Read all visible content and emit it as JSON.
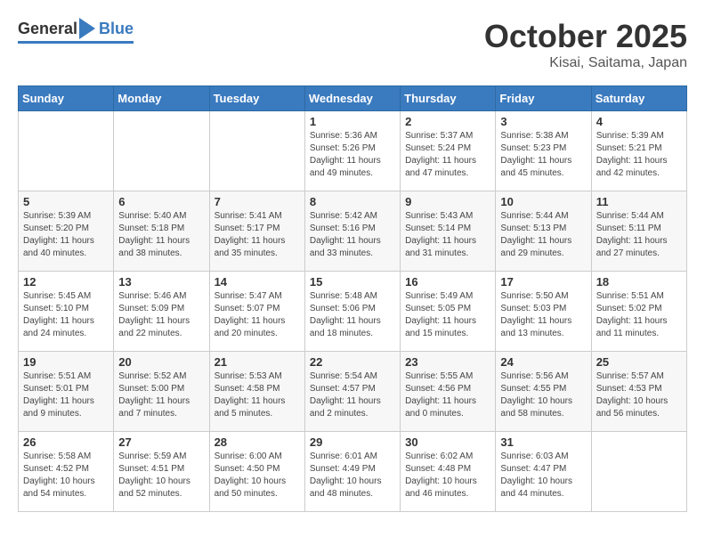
{
  "logo": {
    "general": "General",
    "blue": "Blue"
  },
  "title": "October 2025",
  "location": "Kisai, Saitama, Japan",
  "weekdays": [
    "Sunday",
    "Monday",
    "Tuesday",
    "Wednesday",
    "Thursday",
    "Friday",
    "Saturday"
  ],
  "weeks": [
    [
      {
        "day": "",
        "text": ""
      },
      {
        "day": "",
        "text": ""
      },
      {
        "day": "",
        "text": ""
      },
      {
        "day": "1",
        "text": "Sunrise: 5:36 AM\nSunset: 5:26 PM\nDaylight: 11 hours\nand 49 minutes."
      },
      {
        "day": "2",
        "text": "Sunrise: 5:37 AM\nSunset: 5:24 PM\nDaylight: 11 hours\nand 47 minutes."
      },
      {
        "day": "3",
        "text": "Sunrise: 5:38 AM\nSunset: 5:23 PM\nDaylight: 11 hours\nand 45 minutes."
      },
      {
        "day": "4",
        "text": "Sunrise: 5:39 AM\nSunset: 5:21 PM\nDaylight: 11 hours\nand 42 minutes."
      }
    ],
    [
      {
        "day": "5",
        "text": "Sunrise: 5:39 AM\nSunset: 5:20 PM\nDaylight: 11 hours\nand 40 minutes."
      },
      {
        "day": "6",
        "text": "Sunrise: 5:40 AM\nSunset: 5:18 PM\nDaylight: 11 hours\nand 38 minutes."
      },
      {
        "day": "7",
        "text": "Sunrise: 5:41 AM\nSunset: 5:17 PM\nDaylight: 11 hours\nand 35 minutes."
      },
      {
        "day": "8",
        "text": "Sunrise: 5:42 AM\nSunset: 5:16 PM\nDaylight: 11 hours\nand 33 minutes."
      },
      {
        "day": "9",
        "text": "Sunrise: 5:43 AM\nSunset: 5:14 PM\nDaylight: 11 hours\nand 31 minutes."
      },
      {
        "day": "10",
        "text": "Sunrise: 5:44 AM\nSunset: 5:13 PM\nDaylight: 11 hours\nand 29 minutes."
      },
      {
        "day": "11",
        "text": "Sunrise: 5:44 AM\nSunset: 5:11 PM\nDaylight: 11 hours\nand 27 minutes."
      }
    ],
    [
      {
        "day": "12",
        "text": "Sunrise: 5:45 AM\nSunset: 5:10 PM\nDaylight: 11 hours\nand 24 minutes."
      },
      {
        "day": "13",
        "text": "Sunrise: 5:46 AM\nSunset: 5:09 PM\nDaylight: 11 hours\nand 22 minutes."
      },
      {
        "day": "14",
        "text": "Sunrise: 5:47 AM\nSunset: 5:07 PM\nDaylight: 11 hours\nand 20 minutes."
      },
      {
        "day": "15",
        "text": "Sunrise: 5:48 AM\nSunset: 5:06 PM\nDaylight: 11 hours\nand 18 minutes."
      },
      {
        "day": "16",
        "text": "Sunrise: 5:49 AM\nSunset: 5:05 PM\nDaylight: 11 hours\nand 15 minutes."
      },
      {
        "day": "17",
        "text": "Sunrise: 5:50 AM\nSunset: 5:03 PM\nDaylight: 11 hours\nand 13 minutes."
      },
      {
        "day": "18",
        "text": "Sunrise: 5:51 AM\nSunset: 5:02 PM\nDaylight: 11 hours\nand 11 minutes."
      }
    ],
    [
      {
        "day": "19",
        "text": "Sunrise: 5:51 AM\nSunset: 5:01 PM\nDaylight: 11 hours\nand 9 minutes."
      },
      {
        "day": "20",
        "text": "Sunrise: 5:52 AM\nSunset: 5:00 PM\nDaylight: 11 hours\nand 7 minutes."
      },
      {
        "day": "21",
        "text": "Sunrise: 5:53 AM\nSunset: 4:58 PM\nDaylight: 11 hours\nand 5 minutes."
      },
      {
        "day": "22",
        "text": "Sunrise: 5:54 AM\nSunset: 4:57 PM\nDaylight: 11 hours\nand 2 minutes."
      },
      {
        "day": "23",
        "text": "Sunrise: 5:55 AM\nSunset: 4:56 PM\nDaylight: 11 hours\nand 0 minutes."
      },
      {
        "day": "24",
        "text": "Sunrise: 5:56 AM\nSunset: 4:55 PM\nDaylight: 10 hours\nand 58 minutes."
      },
      {
        "day": "25",
        "text": "Sunrise: 5:57 AM\nSunset: 4:53 PM\nDaylight: 10 hours\nand 56 minutes."
      }
    ],
    [
      {
        "day": "26",
        "text": "Sunrise: 5:58 AM\nSunset: 4:52 PM\nDaylight: 10 hours\nand 54 minutes."
      },
      {
        "day": "27",
        "text": "Sunrise: 5:59 AM\nSunset: 4:51 PM\nDaylight: 10 hours\nand 52 minutes."
      },
      {
        "day": "28",
        "text": "Sunrise: 6:00 AM\nSunset: 4:50 PM\nDaylight: 10 hours\nand 50 minutes."
      },
      {
        "day": "29",
        "text": "Sunrise: 6:01 AM\nSunset: 4:49 PM\nDaylight: 10 hours\nand 48 minutes."
      },
      {
        "day": "30",
        "text": "Sunrise: 6:02 AM\nSunset: 4:48 PM\nDaylight: 10 hours\nand 46 minutes."
      },
      {
        "day": "31",
        "text": "Sunrise: 6:03 AM\nSunset: 4:47 PM\nDaylight: 10 hours\nand 44 minutes."
      },
      {
        "day": "",
        "text": ""
      }
    ]
  ]
}
